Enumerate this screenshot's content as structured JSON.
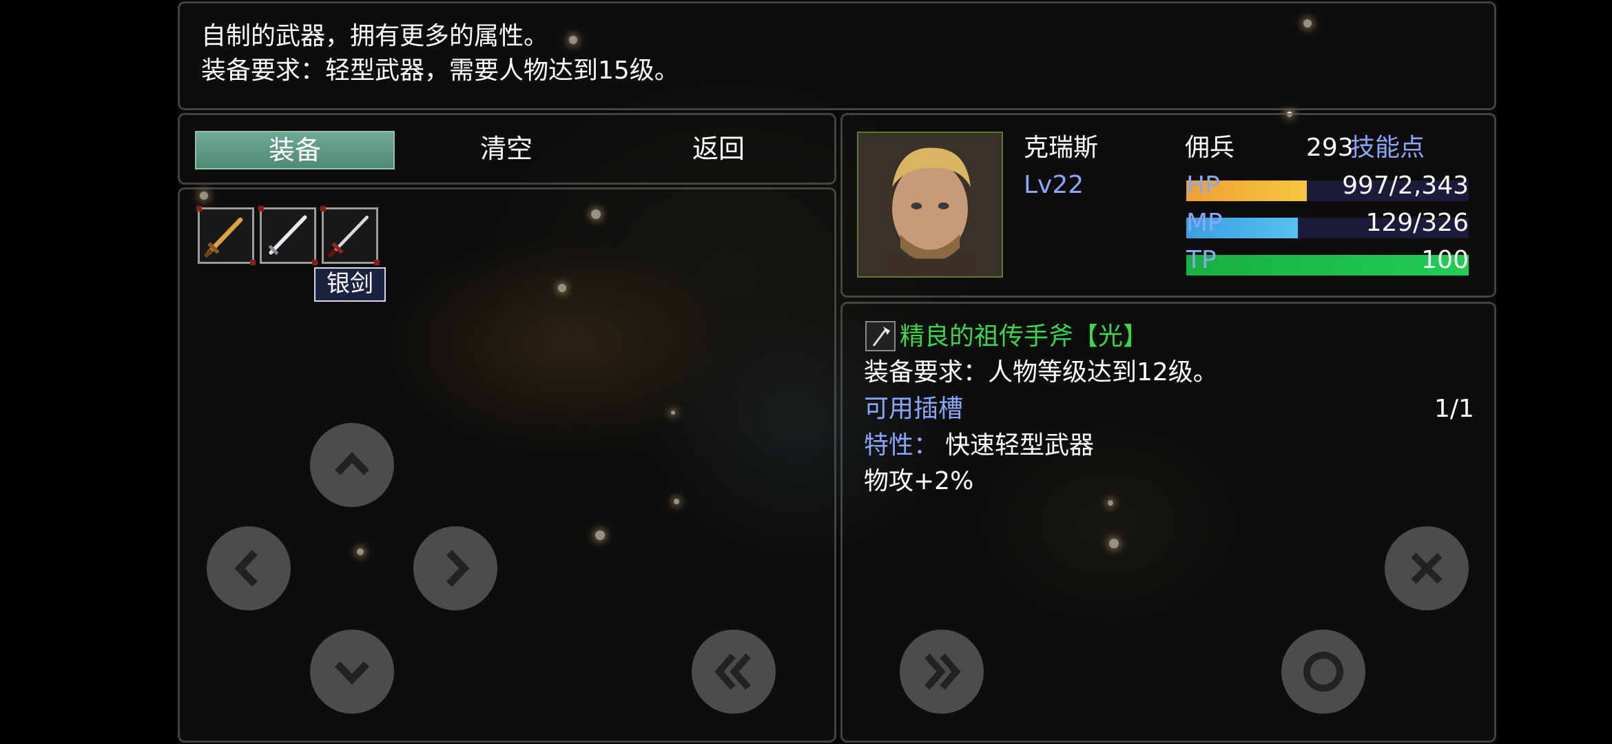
{
  "help": {
    "line1": "自制的武器，拥有更多的属性。",
    "line2": "装备要求：轻型武器，需要人物达到15级。"
  },
  "commands": [
    {
      "label": "装备",
      "selected": true
    },
    {
      "label": "清空",
      "selected": false
    },
    {
      "label": "返回",
      "selected": false
    }
  ],
  "slots": [
    {
      "icon": "golden-sword-icon"
    },
    {
      "icon": "silver-sword-icon"
    },
    {
      "icon": "red-hilt-sword-icon"
    }
  ],
  "tooltip": "银剑",
  "actor": {
    "name": "克瑞斯",
    "class": "佣兵",
    "level": "Lv22",
    "skill_points_value": "293",
    "skill_points_label": "技能点",
    "hp": {
      "label": "HP",
      "text": "997/2,343",
      "fraction": 0.426,
      "color_from": "#f0a030",
      "color_to": "#f5c640"
    },
    "mp": {
      "label": "MP",
      "text": "129/326",
      "fraction": 0.396,
      "color_from": "#3a9fe0",
      "color_to": "#55c2f0"
    },
    "tp": {
      "label": "TP",
      "text": "100",
      "fraction": 1.0,
      "color_from": "#18b040",
      "color_to": "#22cc55"
    }
  },
  "item": {
    "icon": "axe-icon",
    "name": "精良的祖传手斧【光】",
    "requirement": "装备要求：人物等级达到12级。",
    "slots_label": "可用插槽",
    "slots_value": "1/1",
    "trait_label": "特性：",
    "trait_value": "快速轻型武器",
    "stat": "物攻+2%"
  },
  "controls": {
    "up": "chevron-up-icon",
    "left": "chevron-left-icon",
    "right": "chevron-right-icon",
    "down": "chevron-down-icon",
    "page_prev": "double-chevron-left-icon",
    "page_next": "double-chevron-right-icon",
    "cancel": "close-icon",
    "confirm": "circle-icon"
  }
}
